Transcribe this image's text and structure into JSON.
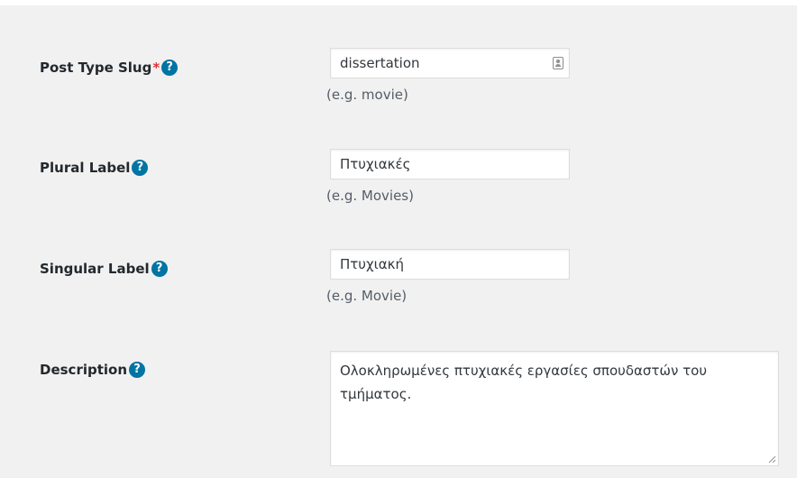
{
  "fields": {
    "slug": {
      "label": "Post Type Slug",
      "required_mark": "*",
      "value": "dissertation",
      "hint": "(e.g. movie)"
    },
    "plural": {
      "label": "Plural Label",
      "value": "Πτυχιακές",
      "hint": "(e.g. Movies)"
    },
    "singular": {
      "label": "Singular Label",
      "value": "Πτυχιακή",
      "hint": "(e.g. Movie)"
    },
    "description": {
      "label": "Description",
      "value": "Ολοκληρωμένες πτυχιακές εργασίες σπουδαστών του τμήματος."
    }
  },
  "help_icon_glyph": "?",
  "colors": {
    "help_icon": "#0074a2",
    "required": "#dc3232",
    "panel_bg": "#f1f1f1"
  }
}
